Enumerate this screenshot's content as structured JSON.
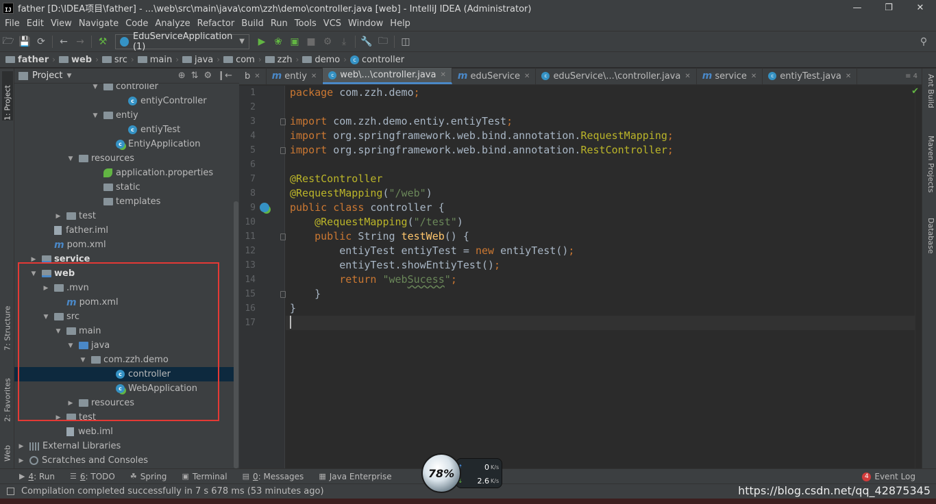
{
  "window": {
    "app_icon": "IJ",
    "title": "father [D:\\IDEA项目\\father] - ...\\web\\src\\main\\java\\com\\zzh\\demo\\controller.java [web] - IntelliJ IDEA (Administrator)",
    "buttons": [
      "minimize-icon",
      "restore-icon",
      "close-icon"
    ]
  },
  "menu": [
    "File",
    "Edit",
    "View",
    "Navigate",
    "Code",
    "Analyze",
    "Refactor",
    "Build",
    "Run",
    "Tools",
    "VCS",
    "Window",
    "Help"
  ],
  "toolbar": {
    "run_config": "EduServiceApplication (1)",
    "icons": [
      "open-folder-icon",
      "save-icon",
      "sync-icon",
      "back-icon",
      "forward-icon",
      "build-hammer-icon",
      "run-icon",
      "debug-icon",
      "coverage-icon",
      "stop-icon",
      "profile-icon",
      "attach-icon",
      "settings-wrench-icon",
      "project-structure-icon",
      "sdk-icon",
      "search-icon"
    ]
  },
  "breadcrumb": [
    "father",
    "web",
    "src",
    "main",
    "java",
    "com",
    "zzh",
    "demo",
    "controller"
  ],
  "left_tabs": [
    "1: Project",
    "7: Structure",
    "2: Favorites",
    "Web"
  ],
  "right_tabs": [
    "Ant Build",
    "Maven Projects",
    "Database"
  ],
  "project_panel": {
    "title": "Project",
    "tree": [
      {
        "label": "controller",
        "depth": 6,
        "arrow": "open",
        "icon": "folder"
      },
      {
        "label": "entiyController",
        "depth": 8,
        "arrow": "",
        "icon": "class"
      },
      {
        "label": "entiy",
        "depth": 6,
        "arrow": "open",
        "icon": "folder"
      },
      {
        "label": "entiyTest",
        "depth": 8,
        "arrow": "",
        "icon": "class"
      },
      {
        "label": "EntiyApplication",
        "depth": 7,
        "arrow": "",
        "icon": "spring-class"
      },
      {
        "label": "resources",
        "depth": 4,
        "arrow": "open",
        "icon": "folder"
      },
      {
        "label": "application.properties",
        "depth": 6,
        "arrow": "",
        "icon": "leaf"
      },
      {
        "label": "static",
        "depth": 6,
        "arrow": "",
        "icon": "folder"
      },
      {
        "label": "templates",
        "depth": 6,
        "arrow": "",
        "icon": "folder"
      },
      {
        "label": "test",
        "depth": 3,
        "arrow": "closed",
        "icon": "folder"
      },
      {
        "label": "father.iml",
        "depth": 2,
        "arrow": "",
        "icon": "file"
      },
      {
        "label": "pom.xml",
        "depth": 2,
        "arrow": "",
        "icon": "maven"
      },
      {
        "label": "service",
        "depth": 1,
        "arrow": "closed",
        "icon": "module",
        "bold": true
      },
      {
        "label": "web",
        "depth": 1,
        "arrow": "open",
        "icon": "module",
        "bold": true
      },
      {
        "label": ".mvn",
        "depth": 2,
        "arrow": "closed",
        "icon": "folder"
      },
      {
        "label": "pom.xml",
        "depth": 3,
        "arrow": "",
        "icon": "maven"
      },
      {
        "label": "src",
        "depth": 2,
        "arrow": "open",
        "icon": "folder"
      },
      {
        "label": "main",
        "depth": 3,
        "arrow": "open",
        "icon": "folder"
      },
      {
        "label": "java",
        "depth": 4,
        "arrow": "open",
        "icon": "folder-blue"
      },
      {
        "label": "com.zzh.demo",
        "depth": 5,
        "arrow": "open",
        "icon": "folder"
      },
      {
        "label": "controller",
        "depth": 7,
        "arrow": "",
        "icon": "class",
        "selected": true
      },
      {
        "label": "WebApplication",
        "depth": 7,
        "arrow": "",
        "icon": "spring-class"
      },
      {
        "label": "resources",
        "depth": 4,
        "arrow": "closed",
        "icon": "folder"
      },
      {
        "label": "test",
        "depth": 3,
        "arrow": "closed",
        "icon": "folder"
      },
      {
        "label": "web.iml",
        "depth": 3,
        "arrow": "",
        "icon": "file"
      },
      {
        "label": "External Libraries",
        "depth": 0,
        "arrow": "closed",
        "icon": "lib"
      },
      {
        "label": "Scratches and Consoles",
        "depth": 0,
        "arrow": "closed",
        "icon": "scratch"
      }
    ]
  },
  "editor": {
    "tabs": [
      {
        "label": "b",
        "icon": "",
        "close": true
      },
      {
        "label": "entiy",
        "icon": "m",
        "close": true
      },
      {
        "label": "web\\...\\controller.java",
        "icon": "c",
        "close": true,
        "active": true
      },
      {
        "label": "eduService",
        "icon": "m",
        "close": true
      },
      {
        "label": "eduService\\...\\controller.java",
        "icon": "c",
        "close": true
      },
      {
        "label": "service",
        "icon": "m",
        "close": true
      },
      {
        "label": "entiyTest.java",
        "icon": "c",
        "close": true
      }
    ],
    "tab_overflow": "≡ 4",
    "code_lines": [
      [
        [
          "kw",
          "package "
        ],
        [
          "",
          "com.zzh.demo"
        ],
        [
          "kw",
          ";"
        ]
      ],
      [],
      [
        [
          "kw",
          "import "
        ],
        [
          "",
          "com.zzh.demo.entiy.entiyTest"
        ],
        [
          "kw",
          ";"
        ]
      ],
      [
        [
          "kw",
          "import "
        ],
        [
          "",
          "org.springframework.web.bind.annotation."
        ],
        [
          "an",
          "RequestMapping"
        ],
        [
          "kw",
          ";"
        ]
      ],
      [
        [
          "kw",
          "import "
        ],
        [
          "",
          "org.springframework.web.bind.annotation."
        ],
        [
          "an",
          "RestController"
        ],
        [
          "kw",
          ";"
        ]
      ],
      [],
      [
        [
          "an",
          "@RestController"
        ]
      ],
      [
        [
          "an",
          "@RequestMapping"
        ],
        [
          "",
          "("
        ],
        [
          "str",
          "\"/web\""
        ],
        [
          "",
          ")"
        ]
      ],
      [
        [
          "kw",
          "public class "
        ],
        [
          "",
          "controller {"
        ]
      ],
      [
        [
          "",
          "    "
        ],
        [
          "an",
          "@RequestMapping"
        ],
        [
          "",
          "("
        ],
        [
          "str",
          "\"/test\""
        ],
        [
          "",
          ")"
        ]
      ],
      [
        [
          "",
          "    "
        ],
        [
          "kw",
          "public "
        ],
        [
          "",
          "String "
        ],
        [
          "fn",
          "testWeb"
        ],
        [
          "",
          "() {"
        ]
      ],
      [
        [
          "",
          "        entiyTest entiyTest = "
        ],
        [
          "kw",
          "new "
        ],
        [
          "",
          "entiyTest()"
        ],
        [
          "kw",
          ";"
        ]
      ],
      [
        [
          "",
          "        entiyTest.showEntiyTest()"
        ],
        [
          "kw",
          ";"
        ]
      ],
      [
        [
          "",
          "        "
        ],
        [
          "kw",
          "return "
        ],
        [
          "str",
          "\"web"
        ],
        [
          "squig",
          "Sucess"
        ],
        [
          "str",
          "\""
        ],
        [
          "kw",
          ";"
        ]
      ],
      [
        [
          "",
          "    }"
        ]
      ],
      [
        [
          "",
          "}"
        ]
      ],
      []
    ]
  },
  "bottom_tools": [
    {
      "icon": "▶",
      "prefix": "4",
      "label": ": Run"
    },
    {
      "icon": "☰",
      "prefix": "6",
      "label": ": TODO"
    },
    {
      "icon": "☘",
      "prefix": "",
      "label": "Spring"
    },
    {
      "icon": "▣",
      "prefix": "",
      "label": "Terminal"
    },
    {
      "icon": "▤",
      "prefix": "0",
      "label": ": Messages"
    },
    {
      "icon": "▦",
      "prefix": "",
      "label": "Java Enterprise"
    }
  ],
  "event_log": {
    "count": "4",
    "label": "Event Log"
  },
  "status": {
    "message": "Compilation completed successfully in 7 s 678 ms (53 minutes ago)"
  },
  "watermark": "https://blog.csdn.net/qq_42875345",
  "net_widget": {
    "percent": "78%",
    "up": "0",
    "down": "2.6",
    "unit": "K/s"
  }
}
